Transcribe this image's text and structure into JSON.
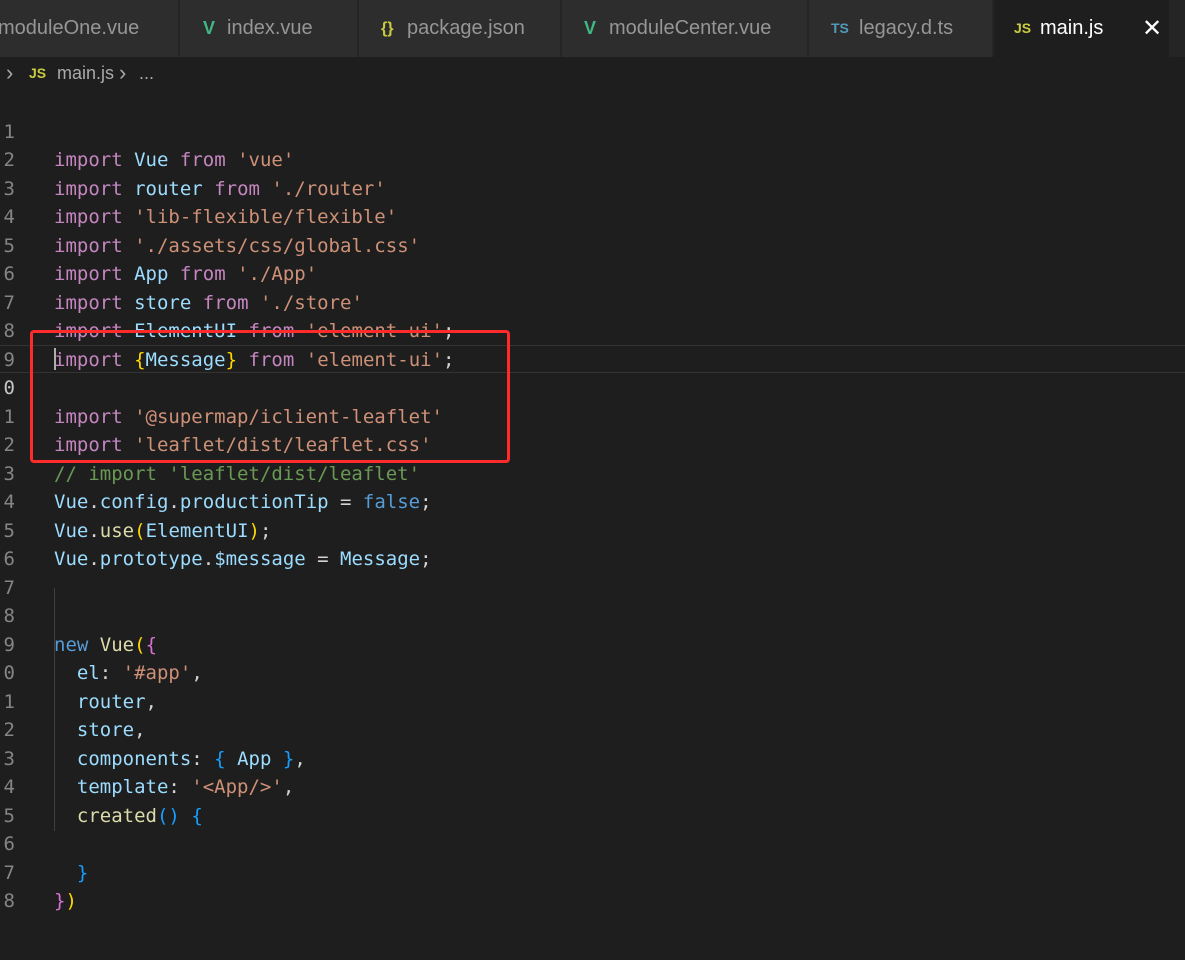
{
  "tabs": [
    {
      "label": "moduleOne.vue",
      "icon": "vue-icon",
      "active": false
    },
    {
      "label": "index.vue",
      "icon": "vue-icon",
      "active": false
    },
    {
      "label": "package.json",
      "icon": "json-icon",
      "active": false
    },
    {
      "label": "moduleCenter.vue",
      "icon": "vue-icon",
      "active": false
    },
    {
      "label": "legacy.d.ts",
      "icon": "ts-icon",
      "active": false
    },
    {
      "label": "main.js",
      "icon": "js-icon",
      "active": true
    }
  ],
  "icon_glyphs": {
    "vue": "V",
    "json": "{}",
    "ts": "TS",
    "js": "JS",
    "close": "✕",
    "chevron": "›"
  },
  "breadcrumb": {
    "file": "main.js",
    "ellipsis": "..."
  },
  "editor": {
    "current_line": 10,
    "highlight_color": "#ff2a2a",
    "lines": [
      {
        "number": "1"
      },
      {
        "number": "2"
      },
      {
        "number": "3"
      },
      {
        "number": "4"
      },
      {
        "number": "5"
      },
      {
        "number": "6"
      },
      {
        "number": "7"
      },
      {
        "number": "8"
      },
      {
        "number": "9"
      },
      {
        "number": "0"
      },
      {
        "number": "1"
      },
      {
        "number": "2"
      },
      {
        "number": "3"
      },
      {
        "number": "4"
      },
      {
        "number": "5"
      },
      {
        "number": "6"
      },
      {
        "number": "7"
      },
      {
        "number": "8"
      },
      {
        "number": "9"
      },
      {
        "number": "0"
      },
      {
        "number": "1"
      },
      {
        "number": "2"
      },
      {
        "number": "3"
      },
      {
        "number": "4"
      },
      {
        "number": "5"
      },
      {
        "number": "6"
      },
      {
        "number": "7"
      },
      {
        "number": "8"
      }
    ],
    "code": {
      "import": "import",
      "from": "from",
      "new": "new",
      "false": "false",
      "Vue": "Vue",
      "router": "router",
      "App": "App",
      "store": "store",
      "ElementUI": "ElementUI",
      "Message": "Message",
      "s_vue": "'vue'",
      "s_router": "'./router'",
      "s_flexible": "'lib-flexible/flexible'",
      "s_global": "'./assets/css/global.css'",
      "s_app": "'./App'",
      "s_store": "'./store'",
      "s_element": "'element-ui'",
      "s_supermap": "'@supermap/iclient-leaflet'",
      "s_leafletcss": "'leaflet/dist/leaflet.css'",
      "comment_leaflet": "// import 'leaflet/dist/leaflet'",
      "config": "config",
      "productionTip": "productionTip",
      "use": "use",
      "prototype": "prototype",
      "message": "$message",
      "el": "el",
      "s_hashapp": "'#app'",
      "components": "components",
      "template": "template",
      "s_apptag": "'<App/>'",
      "created": "created"
    }
  }
}
